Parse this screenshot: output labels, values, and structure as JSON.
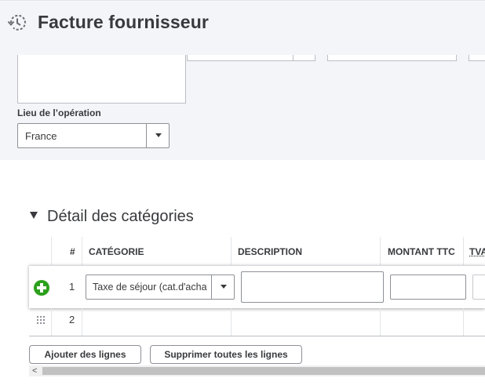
{
  "header": {
    "title": "Facture fournisseur",
    "history_icon": "history-clock-icon"
  },
  "form": {
    "lieu_label": "Lieu de l’opération",
    "lieu_value": "France"
  },
  "categories": {
    "section_title": "Détail des catégories",
    "columns": [
      "#",
      "CATÉGORIE",
      "DESCRIPTION",
      "MONTANT TTC",
      "TVA"
    ],
    "rows": [
      {
        "num": "1",
        "categorie": "Taxe de séjour (cat.d'achat)",
        "description": "",
        "montant": ""
      },
      {
        "num": "2",
        "categorie": "",
        "description": "",
        "montant": ""
      }
    ],
    "add_lines_label": "Ajouter des lignes",
    "clear_lines_label": "Supprimer toutes les lignes"
  },
  "colors": {
    "accent_green": "#2ca01c",
    "header_bg": "#f4f5f8"
  }
}
